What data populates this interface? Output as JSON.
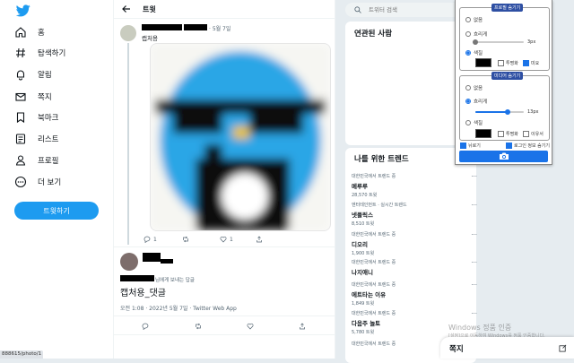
{
  "sidebar": {
    "items": [
      {
        "label": "홈",
        "icon": "home-icon"
      },
      {
        "label": "탐색하기",
        "icon": "hashtag-icon"
      },
      {
        "label": "알림",
        "icon": "bell-icon"
      },
      {
        "label": "쪽지",
        "icon": "mail-icon"
      },
      {
        "label": "북마크",
        "icon": "bookmark-icon"
      },
      {
        "label": "리스트",
        "icon": "list-icon"
      },
      {
        "label": "프로필",
        "icon": "person-icon"
      },
      {
        "label": "더 보기",
        "icon": "more-circle-icon"
      }
    ],
    "tweet_button": "트윗하기"
  },
  "status_url": "888615/photo/1",
  "main": {
    "title": "트윗",
    "tweet1": {
      "date": "· 5월 7일",
      "text": "캡처용",
      "reply_count": "1",
      "like_count": "1"
    },
    "tweet2": {
      "reply_to": "님에게 보내는 답글",
      "text": "캡처용_댓글",
      "meta": "오전 1:08 · 2022년 5월 7일 · Twitter Web App"
    }
  },
  "right": {
    "search_placeholder": "트위터 검색",
    "related_title": "연관된 사람",
    "trends_title": "나를 위한 트렌드",
    "trends": [
      {
        "context": "대한민국에서 트렌드 중",
        "name": "메루루",
        "count": "28,570 트윗"
      },
      {
        "context": "엔터테인먼트 · 실시간 트렌드",
        "name": "넷플릭스",
        "count": "8,510 트윗"
      },
      {
        "context": "대한민국에서 트렌드 중",
        "name": "디오리",
        "count": "1,900 트윗"
      },
      {
        "context": "대한민국에서 트렌드 중",
        "name": "나지애니",
        "count": ""
      },
      {
        "context": "대한민국에서 트렌드 중",
        "name": "에트타는 이유",
        "count": "1,849 트윗"
      },
      {
        "context": "대한민국에서 트렌드 중",
        "name": "다음주 놀토",
        "count": "5,780 트윗"
      },
      {
        "context": "대한민국에서 트렌드 중",
        "name": "",
        "count": ""
      }
    ]
  },
  "ext": {
    "profile_group": "프로필 숨기기",
    "media_group": "미디어 숨기기",
    "opt_none": "없음",
    "opt_blur": "흐리게",
    "opt_color": "색칠",
    "profile_px": "3px",
    "media_px": "13px",
    "transparent": "투명화",
    "circle": "미요",
    "media_circle": "이유서",
    "hide_label": "뉘로기",
    "hide_sensitive": "로그인 정보 숨기기",
    "accent": "#1a73e8"
  },
  "dm": {
    "title": "쪽지"
  },
  "watermark": {
    "line1": "Windows 정품 인증",
    "line2": "[설정]으로 이동하여 Windows를 정품 인증합니다."
  }
}
